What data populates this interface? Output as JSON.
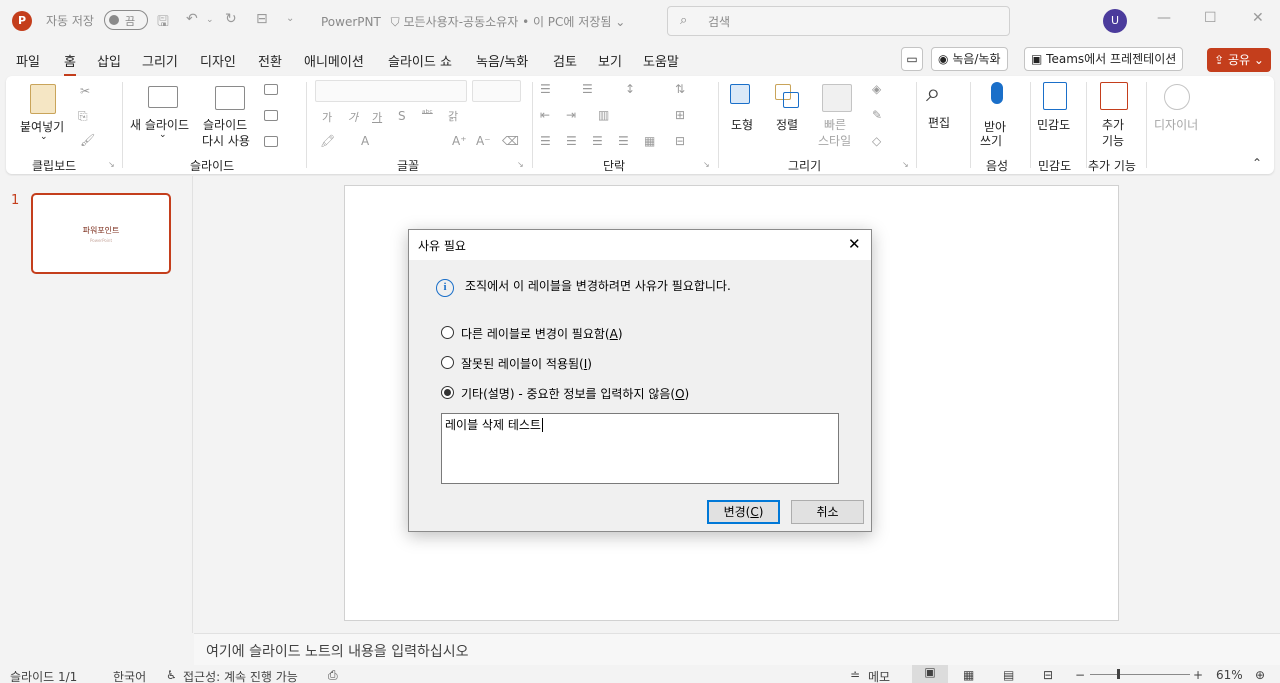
{
  "titlebar": {
    "app_icon_letter": "P",
    "autosave_label": "자동 저장",
    "autosave_state": "끔",
    "doc_name": "PowerPNT",
    "sensitivity": "모든사용자-공동소유자",
    "save_location": "• 이 PC에 저장됨",
    "search_placeholder": "검색",
    "avatar_initial": "U"
  },
  "tabs": [
    "파일",
    "홈",
    "삽입",
    "그리기",
    "디자인",
    "전환",
    "애니메이션",
    "슬라이드 쇼",
    "녹음/녹화",
    "검토",
    "보기",
    "도움말"
  ],
  "active_tab": "홈",
  "tab_actions": {
    "record_label": "녹음/녹화",
    "teams_label": "Teams에서 프레젠테이션",
    "share_label": "공유"
  },
  "ribbon": {
    "paste_label": "붙여넣기",
    "new_slide_label": "새 슬라이드",
    "reuse_slide_line1": "슬라이드",
    "reuse_slide_line2": "다시 사용",
    "shapes_label": "도형",
    "arrange_label": "정렬",
    "quick_styles_line1": "빠른",
    "quick_styles_line2": "스타일",
    "editing_label": "편집",
    "dictate_line1": "받아",
    "dictate_line2": "쓰기",
    "sensitivity_label": "민감도",
    "addins_line1": "추가",
    "addins_line2": "기능",
    "designer_label": "디자이너",
    "groups": {
      "clipboard": "클립보드",
      "slides": "슬라이드",
      "font": "글꼴",
      "paragraph": "단락",
      "drawing": "그리기",
      "voice": "음성",
      "sensitivity": "민감도",
      "addins": "추가 기능"
    },
    "font_buttons": [
      "가",
      "가",
      "가",
      "S",
      "ᵃᵇᶜ",
      "갉"
    ]
  },
  "thumbnail": {
    "number": "1",
    "title": "파워포인트",
    "subtitle": "PowerPoint"
  },
  "notes_placeholder": "여기에 슬라이드 노트의 내용을 입력하십시오",
  "statusbar": {
    "slide_counter": "슬라이드 1/1",
    "language": "한국어",
    "accessibility": "접근성: 계속 진행 가능",
    "notes_btn": "메모",
    "zoom": "61%"
  },
  "dialog": {
    "title": "사유 필요",
    "message": "조직에서 이 레이블을 변경하려면 사유가 필요합니다.",
    "options": [
      {
        "label": "다른 레이블로 변경이 필요함(",
        "key": "A",
        "checked": false
      },
      {
        "label": "잘못된 레이블이 적용됨(",
        "key": "I",
        "checked": false
      },
      {
        "label": "기타(설명) - 중요한 정보를 입력하지 않음(",
        "key": "O",
        "checked": true
      }
    ],
    "textarea_value": "레이블 삭제 테스트",
    "ok_label": "변경(",
    "ok_key": "C",
    "cancel_label": "취소"
  }
}
